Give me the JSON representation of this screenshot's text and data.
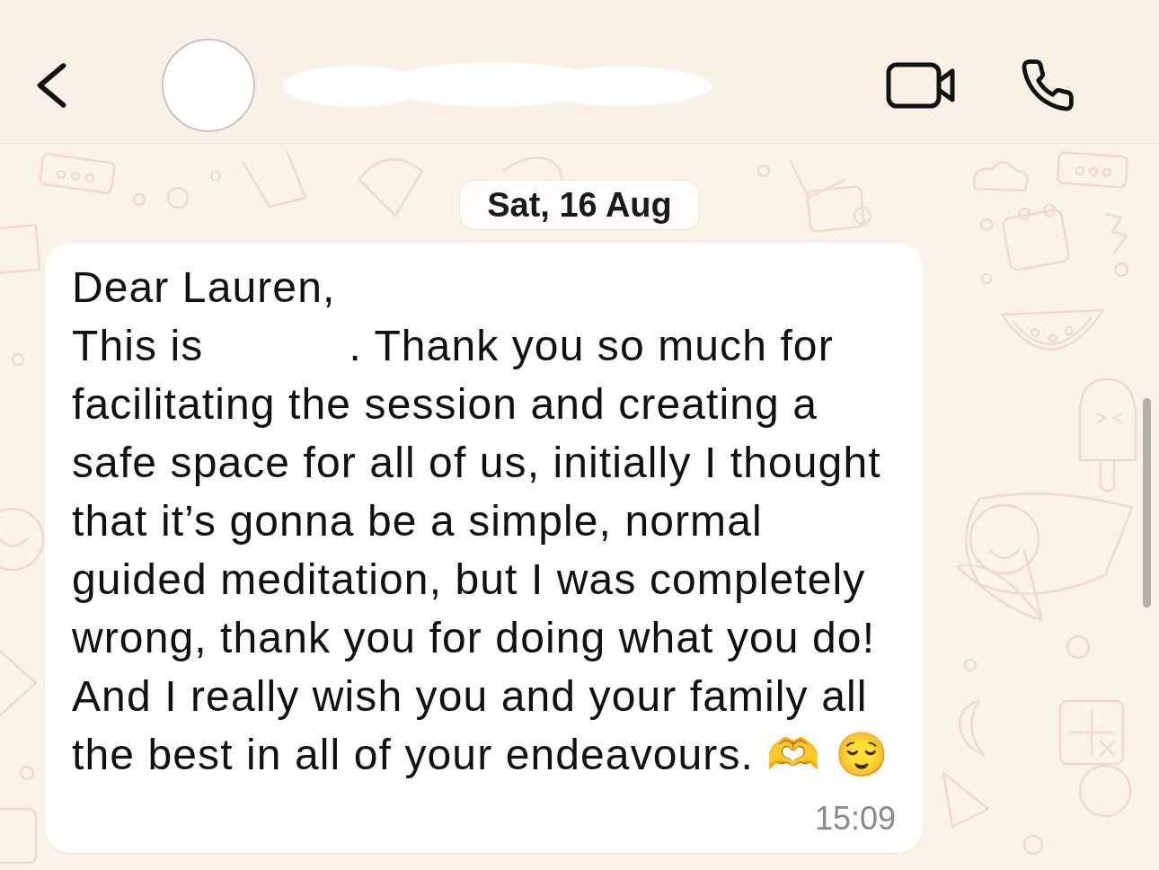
{
  "date_divider": "Sat, 16 Aug",
  "message": {
    "kind": "incoming",
    "lines": [
      [
        {
          "kind": "text",
          "text": "Dear Lauren,"
        }
      ],
      [
        {
          "kind": "text",
          "text": "This is"
        },
        {
          "kind": "redacted"
        },
        {
          "kind": "text",
          "text": ". Thank you so much for"
        }
      ],
      [
        {
          "kind": "text",
          "text": "facilitating the session and creating a"
        }
      ],
      [
        {
          "kind": "text",
          "text": "safe space for all of us, initially I thought"
        }
      ],
      [
        {
          "kind": "text",
          "text": "that it’s gonna be a simple, normal"
        }
      ],
      [
        {
          "kind": "text",
          "text": "guided meditation, but I was completely"
        }
      ],
      [
        {
          "kind": "text",
          "text": "wrong, thank you for doing what you do!"
        }
      ],
      [
        {
          "kind": "text",
          "text": "And I really wish you and your family all"
        }
      ],
      [
        {
          "kind": "text",
          "text": "the best in all of your endeavours. 🫶 😌"
        }
      ]
    ],
    "time": "15:09"
  }
}
